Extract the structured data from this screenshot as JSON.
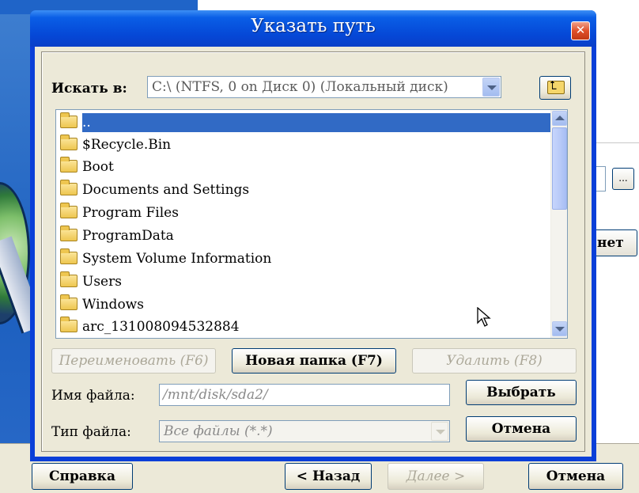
{
  "dialog": {
    "title": "Указать путь",
    "close_glyph": "✕",
    "look_in_label": "Искать в:",
    "look_in_value": "C:\\  (NTFS, 0 on Диск 0) (Локальный диск)",
    "files": [
      {
        "name": "..",
        "selected": true
      },
      {
        "name": "$Recycle.Bin"
      },
      {
        "name": "Boot"
      },
      {
        "name": "Documents and Settings"
      },
      {
        "name": "Program Files"
      },
      {
        "name": "ProgramData"
      },
      {
        "name": "System Volume Information"
      },
      {
        "name": "Users"
      },
      {
        "name": "Windows"
      },
      {
        "name": "arc_131008094532884"
      }
    ],
    "rename_button": "Переименовать (F6)",
    "new_folder_button": "Новая папка (F7)",
    "delete_button": "Удалить (F8)",
    "file_name_label": "Имя файла:",
    "file_name_value": "/mnt/disk/sda2/",
    "file_type_label": "Тип файла:",
    "file_type_value": "Все файлы (*.*)",
    "select_button": "Выбрать",
    "cancel_button": "Отмена"
  },
  "wizard": {
    "help_button": "Справка",
    "back_button": "< Назад",
    "next_button": "Далее >",
    "cancel_button": "Отмена",
    "browse_button": "...",
    "partial_button": "нет"
  },
  "icons": {
    "folder": "folder-icon",
    "up_folder": "up-folder-icon",
    "close": "close-icon",
    "cursor": "mouse-cursor-icon"
  },
  "colors": {
    "title_bar": "#0547d6",
    "selection": "#316ac5",
    "dialog_face": "#ece9d8"
  }
}
